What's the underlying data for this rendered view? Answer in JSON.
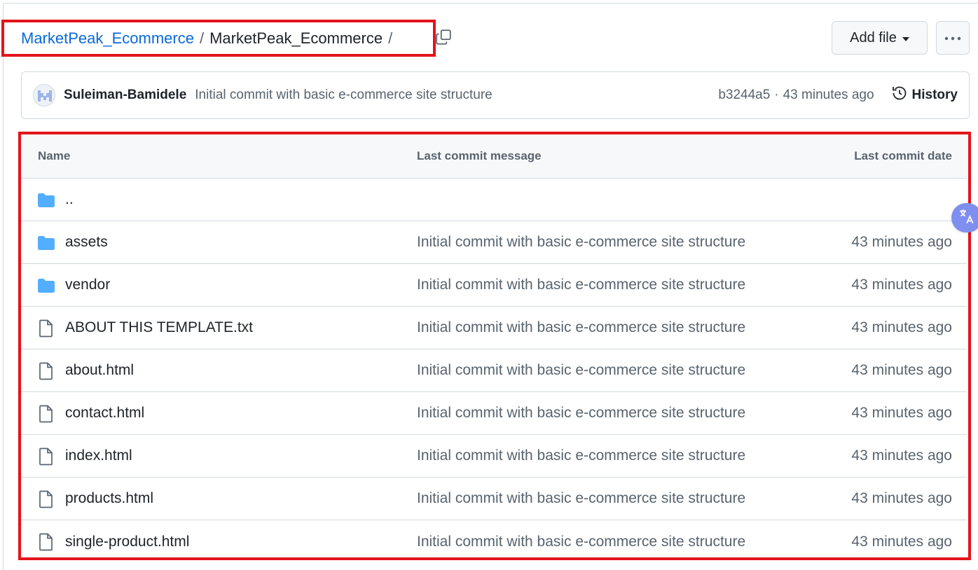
{
  "breadcrumb": {
    "repo_link": "MarketPeak_Ecommerce",
    "separator": "/",
    "current": "MarketPeak_Ecommerce",
    "trailing_separator": "/"
  },
  "toolbar": {
    "add_file_label": "Add file",
    "more_label": "···"
  },
  "latest_commit": {
    "author": "Suleiman-Bamidele",
    "message": "Initial commit with basic e-commerce site structure",
    "sha": "b3244a5",
    "dot": "·",
    "time": "43 minutes ago",
    "history_label": "History"
  },
  "table": {
    "headers": {
      "name": "Name",
      "message": "Last commit message",
      "date": "Last commit date"
    },
    "rows": [
      {
        "type": "folder",
        "name": "..",
        "message": "",
        "date": ""
      },
      {
        "type": "folder",
        "name": "assets",
        "message": "Initial commit with basic e-commerce site structure",
        "date": "43 minutes ago"
      },
      {
        "type": "folder",
        "name": "vendor",
        "message": "Initial commit with basic e-commerce site structure",
        "date": "43 minutes ago"
      },
      {
        "type": "file",
        "name": "ABOUT THIS TEMPLATE.txt",
        "message": "Initial commit with basic e-commerce site structure",
        "date": "43 minutes ago"
      },
      {
        "type": "file",
        "name": "about.html",
        "message": "Initial commit with basic e-commerce site structure",
        "date": "43 minutes ago"
      },
      {
        "type": "file",
        "name": "contact.html",
        "message": "Initial commit with basic e-commerce site structure",
        "date": "43 minutes ago"
      },
      {
        "type": "file",
        "name": "index.html",
        "message": "Initial commit with basic e-commerce site structure",
        "date": "43 minutes ago"
      },
      {
        "type": "file",
        "name": "products.html",
        "message": "Initial commit with basic e-commerce site structure",
        "date": "43 minutes ago"
      },
      {
        "type": "file",
        "name": "single-product.html",
        "message": "Initial commit with basic e-commerce site structure",
        "date": "43 minutes ago"
      }
    ]
  },
  "icons": {
    "folder": "folder-icon",
    "file": "file-icon",
    "copy": "copy-icon",
    "history": "history-icon",
    "translate": "translate-icon"
  },
  "colors": {
    "link": "#0969da",
    "folder": "#54aeff",
    "highlight_outline": "#e3141b",
    "muted_text": "#59636e",
    "border": "#d1d9e0"
  }
}
